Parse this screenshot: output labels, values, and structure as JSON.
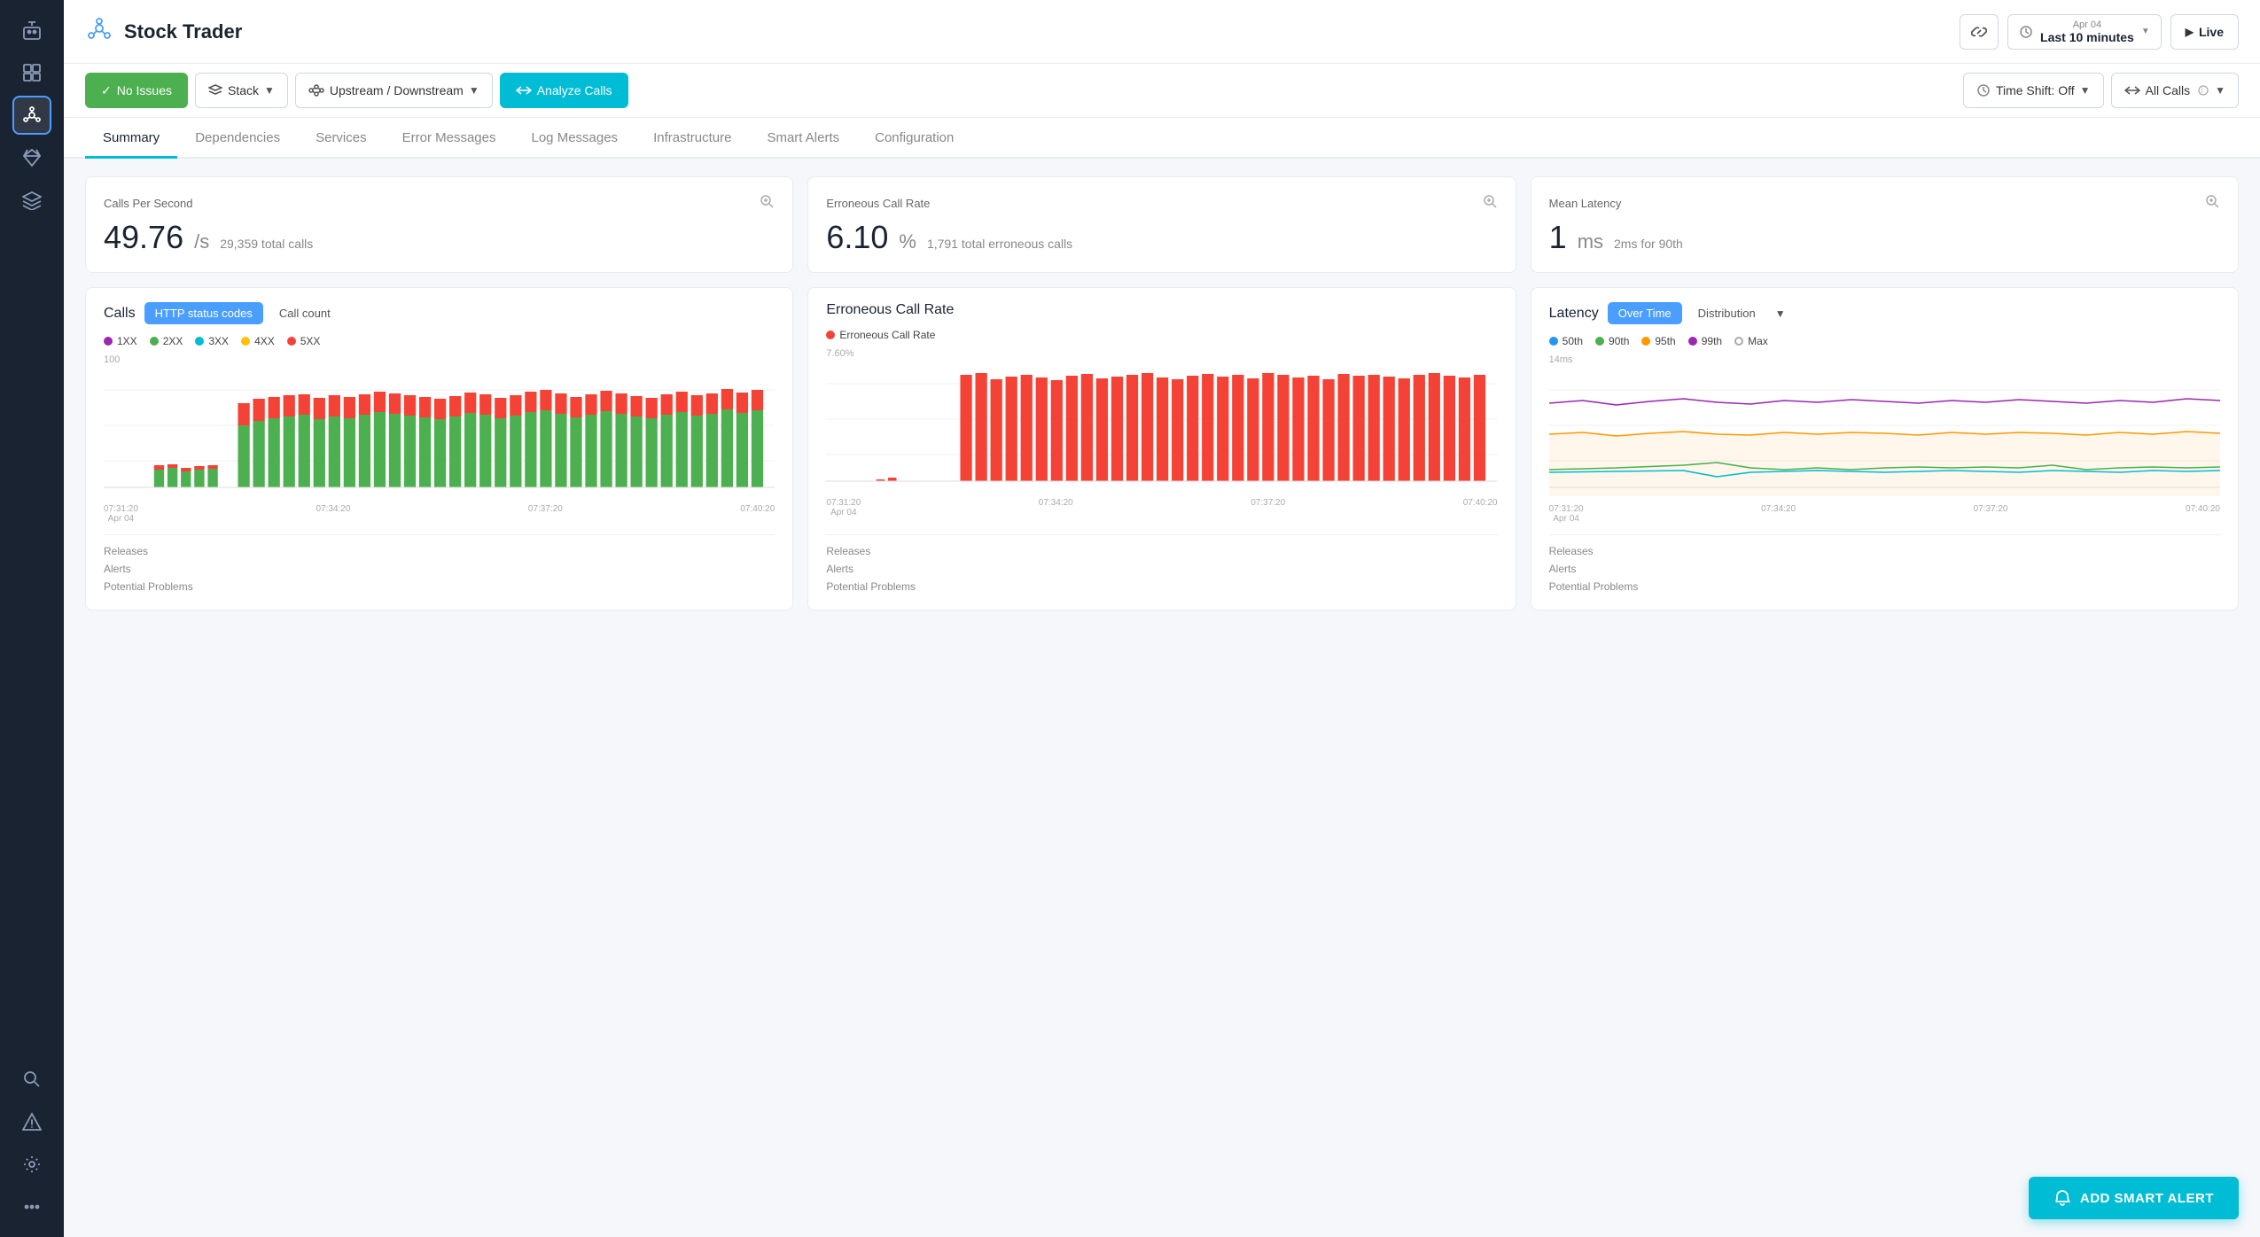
{
  "sidebar": {
    "icons": [
      {
        "name": "robot-icon",
        "symbol": "🤖",
        "active": false
      },
      {
        "name": "dashboard-icon",
        "symbol": "⊞",
        "active": false
      },
      {
        "name": "services-icon",
        "symbol": "⊕",
        "active": true
      },
      {
        "name": "gem-icon",
        "symbol": "💎",
        "active": false
      },
      {
        "name": "layers-icon",
        "symbol": "⬡",
        "active": false
      },
      {
        "name": "search-icon",
        "symbol": "🔍",
        "active": false
      },
      {
        "name": "alert-icon",
        "symbol": "⚠",
        "active": false
      },
      {
        "name": "settings-icon",
        "symbol": "⚙",
        "active": false
      },
      {
        "name": "more-icon",
        "symbol": "···",
        "active": false
      }
    ]
  },
  "header": {
    "app_icon": "⊕",
    "title": "Stock Trader",
    "link_icon": "🔗",
    "time_icon": "🕐",
    "time_date": "Apr 04",
    "time_label": "Last 10 minutes",
    "live_label": "Live"
  },
  "toolbar": {
    "no_issues": "No Issues",
    "stack": "Stack",
    "upstream_downstream": "Upstream / Downstream",
    "analyze_calls": "Analyze Calls",
    "time_shift": "Time Shift: Off",
    "all_calls": "All Calls"
  },
  "tabs": [
    {
      "label": "Summary",
      "active": true
    },
    {
      "label": "Dependencies",
      "active": false
    },
    {
      "label": "Services",
      "active": false
    },
    {
      "label": "Error Messages",
      "active": false
    },
    {
      "label": "Log Messages",
      "active": false
    },
    {
      "label": "Infrastructure",
      "active": false
    },
    {
      "label": "Smart Alerts",
      "active": false
    },
    {
      "label": "Configuration",
      "active": false
    }
  ],
  "metrics": [
    {
      "label": "Calls Per Second",
      "big": "49.76",
      "unit": "/s",
      "sub": "29,359 total calls"
    },
    {
      "label": "Erroneous Call Rate",
      "big": "6.10",
      "unit": "%",
      "sub": "1,791 total erroneous calls"
    },
    {
      "label": "Mean Latency",
      "big": "1",
      "unit": "ms",
      "sub": "2ms for 90th"
    }
  ],
  "charts": [
    {
      "title": "Calls",
      "tab1": "HTTP status codes",
      "tab2": "Call count",
      "legend": [
        {
          "label": "1XX",
          "color": "#9c27b0"
        },
        {
          "label": "2XX",
          "color": "#4caf50"
        },
        {
          "label": "3XX",
          "color": "#00bcd4"
        },
        {
          "label": "4XX",
          "color": "#ffc107"
        },
        {
          "label": "5XX",
          "color": "#f44336"
        }
      ],
      "y_label": "100",
      "x_labels": [
        "07:31:20\nApr 04",
        "07:34:20",
        "07:37:20",
        "07:40:20"
      ],
      "footer": [
        "Releases",
        "Alerts",
        "Potential Problems"
      ],
      "type": "stacked_bar"
    },
    {
      "title": "Erroneous Call Rate",
      "legend": [
        {
          "label": "Erroneous Call Rate",
          "color": "#f44336"
        }
      ],
      "y_label": "7.60%",
      "x_labels": [
        "07:31:20\nApr 04",
        "07:34:20",
        "07:37:20",
        "07:40:20"
      ],
      "footer": [
        "Releases",
        "Alerts",
        "Potential Problems"
      ],
      "type": "bar"
    },
    {
      "title": "Latency",
      "tab1": "Over Time",
      "tab2": "Distribution",
      "legend": [
        {
          "label": "50th",
          "color": "#2196f3"
        },
        {
          "label": "90th",
          "color": "#4caf50"
        },
        {
          "label": "95th",
          "color": "#ff9800"
        },
        {
          "label": "99th",
          "color": "#9c27b0"
        },
        {
          "label": "Max",
          "color": null
        }
      ],
      "y_label": "14ms",
      "x_labels": [
        "07:31:20\nApr 04",
        "07:34:20",
        "07:37:20",
        "07:40:20"
      ],
      "footer": [
        "Releases",
        "Alerts",
        "Potential Problems"
      ],
      "type": "line"
    }
  ],
  "add_alert_label": "ADD SMART ALERT"
}
